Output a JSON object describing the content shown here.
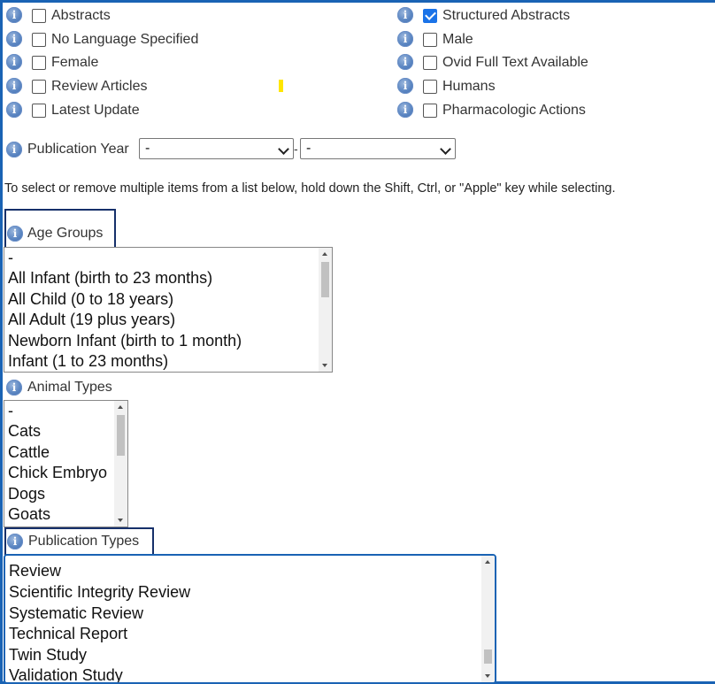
{
  "limits": {
    "left_column": [
      {
        "label": "Abstracts",
        "checked": false
      },
      {
        "label": "No Language Specified",
        "checked": false
      },
      {
        "label": "Female",
        "checked": false
      },
      {
        "label": "Review Articles",
        "checked": false
      },
      {
        "label": "Latest Update",
        "checked": false
      }
    ],
    "right_column": [
      {
        "label": "Structured Abstracts",
        "checked": true
      },
      {
        "label": "Male",
        "checked": false
      },
      {
        "label": "Ovid Full Text Available",
        "checked": false
      },
      {
        "label": "Humans",
        "checked": false
      },
      {
        "label": "Pharmacologic Actions",
        "checked": false
      }
    ]
  },
  "publication_year": {
    "label": "Publication Year",
    "from_value": "-",
    "separator": "-",
    "to_value": "-"
  },
  "instructions": "To select or remove multiple items from a list below, hold down the Shift, Ctrl, or \"Apple\" key while selecting.",
  "age_groups": {
    "label": "Age Groups",
    "options": [
      "-",
      "All Infant (birth to 23 months)",
      "All Child (0 to 18 years)",
      "All Adult (19 plus years)",
      "Newborn Infant (birth to 1 month)",
      "Infant (1 to 23 months)"
    ]
  },
  "animal_types": {
    "label": "Animal Types",
    "options": [
      "-",
      "Cats",
      "Cattle",
      "Chick Embryo",
      "Dogs",
      "Goats"
    ]
  },
  "publication_types": {
    "label": "Publication Types",
    "options": [
      "Review",
      "Scientific Integrity Review",
      "Systematic Review",
      "Technical Report",
      "Twin Study",
      "Validation Study"
    ]
  },
  "icons": {
    "info": "info-icon",
    "checkbox": "checkbox-icon",
    "dropdown": "chevron-down-icon"
  },
  "colors": {
    "frame": "#1a63b4",
    "checkbox_checked": "#1a73e8",
    "highlight_box": "#16306a",
    "marker": "#ffe600"
  }
}
